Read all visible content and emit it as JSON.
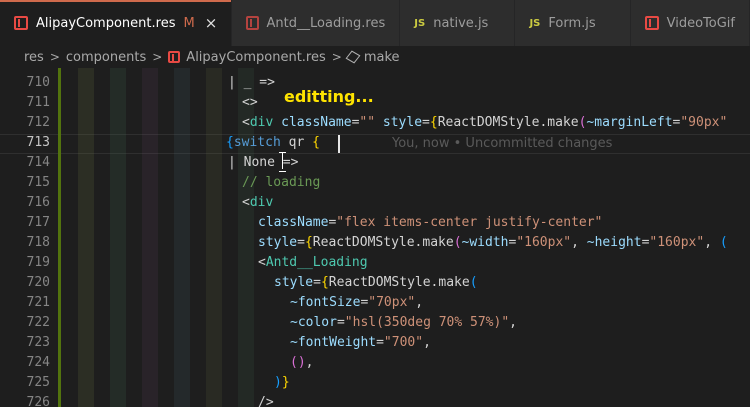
{
  "tabs": [
    {
      "label": "AlipayComponent.res",
      "icon": "rescript-file-icon",
      "modified": "M",
      "close": "×",
      "active": true
    },
    {
      "label": "Antd__Loading.res",
      "icon": "rescript-file-icon"
    },
    {
      "label": "native.js",
      "icon": "js-file-icon",
      "badge": "JS"
    },
    {
      "label": "Form.js",
      "icon": "js-file-icon",
      "badge": "JS"
    },
    {
      "label": "VideoToGif",
      "icon": "rescript-file-icon"
    }
  ],
  "breadcrumb": {
    "items": [
      "res",
      "components",
      "AlipayComponent.res",
      "make"
    ],
    "separator": ">"
  },
  "overlay": {
    "editing_text": "editting..."
  },
  "blame": {
    "text": "You, now • Uncommitted changes"
  },
  "editor": {
    "current_line": 713,
    "lines": [
      {
        "num": "710",
        "tokens": [
          {
            "t": "| _ =>",
            "c": "c-def"
          }
        ],
        "indent": 228
      },
      {
        "num": "711",
        "tokens": [
          {
            "t": "<>",
            "c": "c-def"
          }
        ],
        "indent": 242
      },
      {
        "num": "712",
        "tokens": [
          {
            "t": "<",
            "c": "c-def"
          },
          {
            "t": "div",
            "c": "c-tag"
          },
          {
            "t": " ",
            "c": "c-def"
          },
          {
            "t": "className",
            "c": "c-attr"
          },
          {
            "t": "=",
            "c": "c-def"
          },
          {
            "t": "\"\"",
            "c": "c-str"
          },
          {
            "t": " ",
            "c": "c-def"
          },
          {
            "t": "style",
            "c": "c-attr"
          },
          {
            "t": "=",
            "c": "c-def"
          },
          {
            "t": "{",
            "c": "c-br1"
          },
          {
            "t": "ReactDOMStyle.make",
            "c": "c-def"
          },
          {
            "t": "(",
            "c": "c-br2"
          },
          {
            "t": "~marginLeft",
            "c": "c-attr"
          },
          {
            "t": "=",
            "c": "c-def"
          },
          {
            "t": "\"90px\"",
            "c": "c-str"
          }
        ],
        "indent": 242
      },
      {
        "num": "713",
        "tokens": [
          {
            "t": "{",
            "c": "c-br3"
          },
          {
            "t": "switch",
            "c": "c-kw"
          },
          {
            "t": " qr ",
            "c": "c-def"
          },
          {
            "t": "{",
            "c": "c-br1"
          }
        ],
        "indent": 226
      },
      {
        "num": "714",
        "tokens": [
          {
            "t": "| None ",
            "c": "c-def"
          },
          {
            "t": "=>",
            "c": "c-def"
          }
        ],
        "indent": 228
      },
      {
        "num": "715",
        "tokens": [
          {
            "t": "// loading",
            "c": "c-comment"
          }
        ],
        "indent": 242
      },
      {
        "num": "716",
        "tokens": [
          {
            "t": "<",
            "c": "c-def"
          },
          {
            "t": "div",
            "c": "c-tag"
          }
        ],
        "indent": 242
      },
      {
        "num": "717",
        "tokens": [
          {
            "t": "className",
            "c": "c-attr"
          },
          {
            "t": "=",
            "c": "c-def"
          },
          {
            "t": "\"flex items-center justify-center\"",
            "c": "c-str"
          }
        ],
        "indent": 258
      },
      {
        "num": "718",
        "tokens": [
          {
            "t": "style",
            "c": "c-attr"
          },
          {
            "t": "=",
            "c": "c-def"
          },
          {
            "t": "{",
            "c": "c-br1"
          },
          {
            "t": "ReactDOMStyle.make",
            "c": "c-def"
          },
          {
            "t": "(",
            "c": "c-br2"
          },
          {
            "t": "~width",
            "c": "c-attr"
          },
          {
            "t": "=",
            "c": "c-def"
          },
          {
            "t": "\"160px\"",
            "c": "c-str"
          },
          {
            "t": ", ",
            "c": "c-def"
          },
          {
            "t": "~height",
            "c": "c-attr"
          },
          {
            "t": "=",
            "c": "c-def"
          },
          {
            "t": "\"160px\"",
            "c": "c-str"
          },
          {
            "t": ", ",
            "c": "c-def"
          },
          {
            "t": "(",
            "c": "c-br3"
          }
        ],
        "indent": 258
      },
      {
        "num": "719",
        "tokens": [
          {
            "t": "<",
            "c": "c-def"
          },
          {
            "t": "Antd__Loading",
            "c": "c-tag"
          }
        ],
        "indent": 258
      },
      {
        "num": "720",
        "tokens": [
          {
            "t": "style",
            "c": "c-attr"
          },
          {
            "t": "=",
            "c": "c-def"
          },
          {
            "t": "{",
            "c": "c-br1"
          },
          {
            "t": "ReactDOMStyle.make",
            "c": "c-def"
          },
          {
            "t": "(",
            "c": "c-br3"
          }
        ],
        "indent": 274
      },
      {
        "num": "721",
        "tokens": [
          {
            "t": "~fontSize",
            "c": "c-attr"
          },
          {
            "t": "=",
            "c": "c-def"
          },
          {
            "t": "\"70px\"",
            "c": "c-str"
          },
          {
            "t": ",",
            "c": "c-def"
          }
        ],
        "indent": 290
      },
      {
        "num": "722",
        "tokens": [
          {
            "t": "~color",
            "c": "c-attr"
          },
          {
            "t": "=",
            "c": "c-def"
          },
          {
            "t": "\"hsl(350deg 70% 57%)\"",
            "c": "c-str"
          },
          {
            "t": ",",
            "c": "c-def"
          }
        ],
        "indent": 290
      },
      {
        "num": "723",
        "tokens": [
          {
            "t": "~fontWeight",
            "c": "c-attr"
          },
          {
            "t": "=",
            "c": "c-def"
          },
          {
            "t": "\"700\"",
            "c": "c-str"
          },
          {
            "t": ",",
            "c": "c-def"
          }
        ],
        "indent": 290
      },
      {
        "num": "724",
        "tokens": [
          {
            "t": "()",
            "c": "c-br2"
          },
          {
            "t": ",",
            "c": "c-def"
          }
        ],
        "indent": 290
      },
      {
        "num": "725",
        "tokens": [
          {
            "t": ")",
            "c": "c-br3"
          },
          {
            "t": "}",
            "c": "c-br1"
          }
        ],
        "indent": 274
      },
      {
        "num": "726",
        "tokens": [
          {
            "t": "/>",
            "c": "c-def"
          }
        ],
        "indent": 258
      }
    ]
  }
}
